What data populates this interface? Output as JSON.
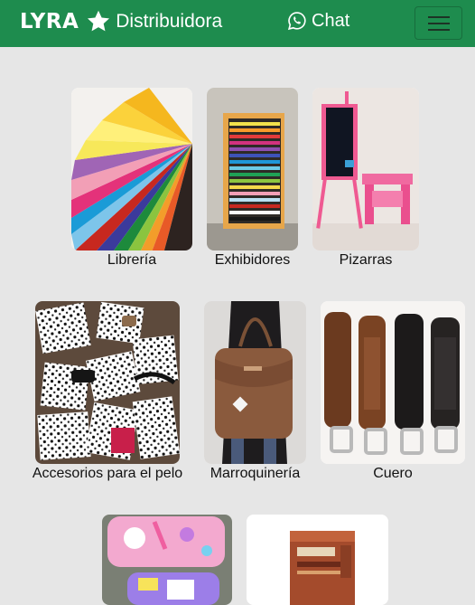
{
  "navbar": {
    "brand_logo": "LYRA",
    "brand_text": "Distribuidora",
    "chat_label": "Chat",
    "background_color": "#1e8c4e",
    "icons": [
      "star-icon",
      "whatsapp-icon",
      "hamburger-menu-icon"
    ]
  },
  "categories": [
    {
      "label": "Librería"
    },
    {
      "label": "Exhibidores"
    },
    {
      "label": "Pizarras"
    },
    {
      "label": "Accesorios para el pelo"
    },
    {
      "label": "Marroquinería"
    },
    {
      "label": "Cuero"
    },
    {
      "label": ""
    },
    {
      "label": ""
    }
  ]
}
